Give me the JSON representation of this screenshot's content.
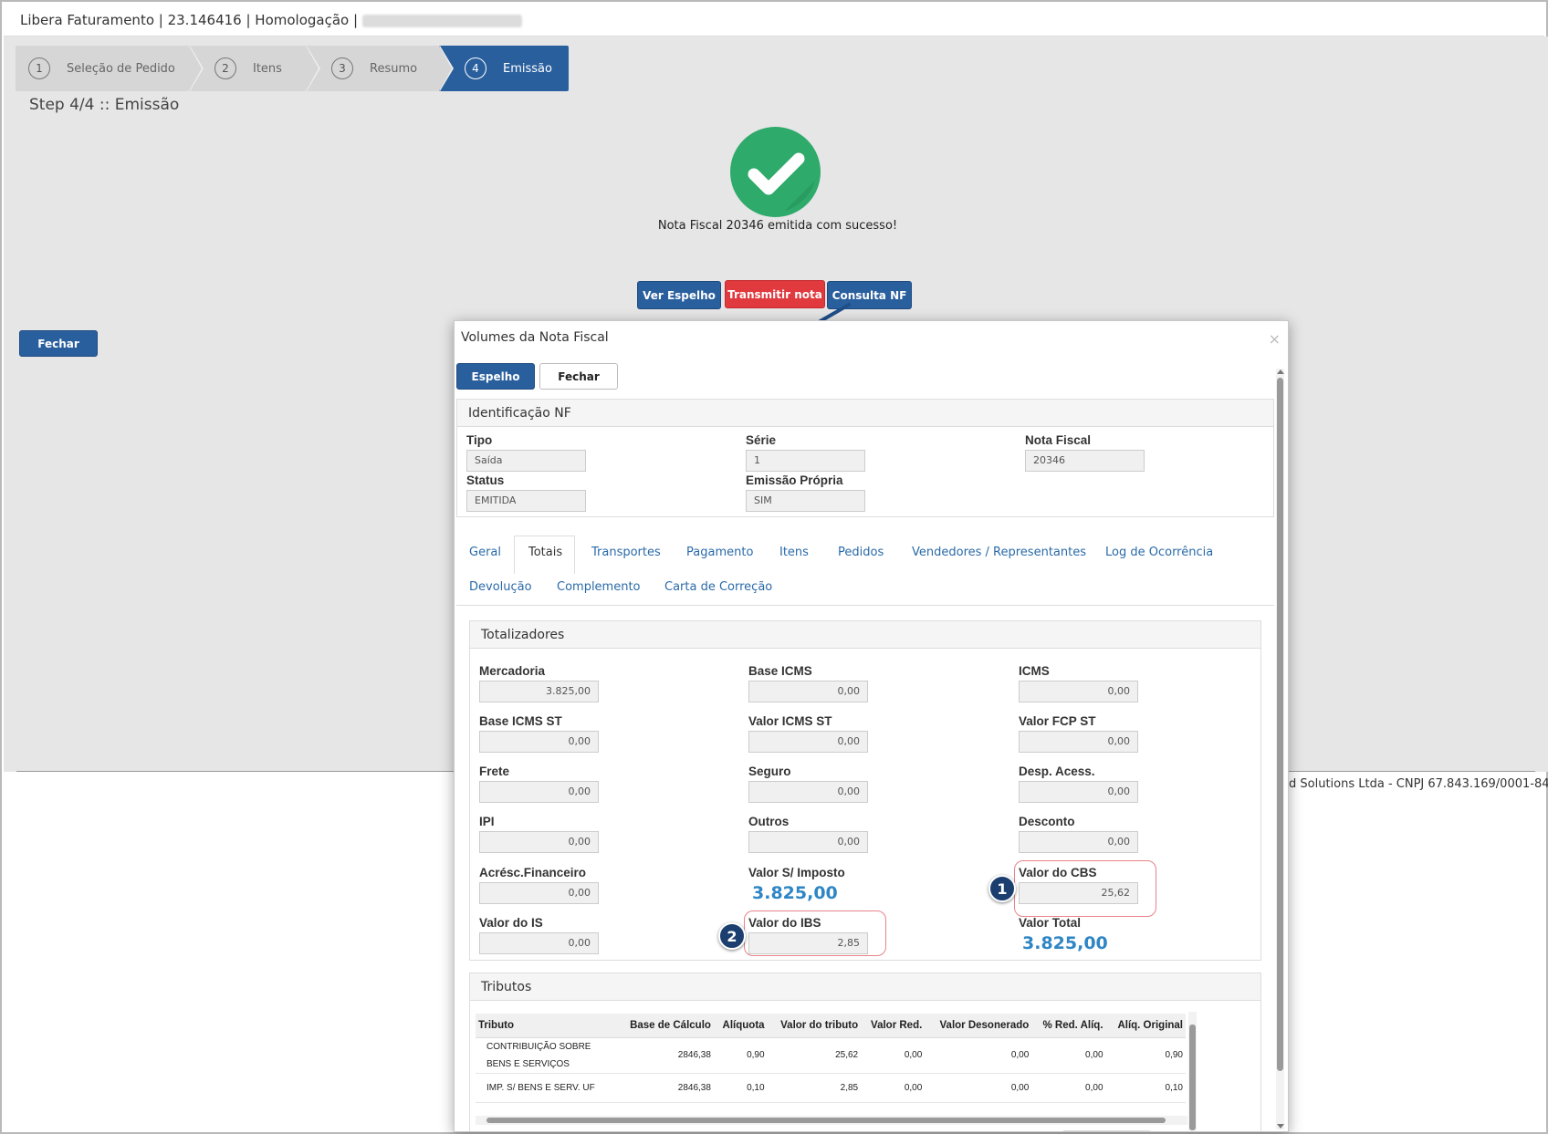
{
  "header": {
    "title": "Libera Faturamento | 23.146416 | Homologação |"
  },
  "wizard": {
    "steps": [
      {
        "num": "1",
        "label": "Seleção de Pedido"
      },
      {
        "num": "2",
        "label": "Itens"
      },
      {
        "num": "3",
        "label": "Resumo"
      },
      {
        "num": "4",
        "label": "Emissão"
      }
    ],
    "step_title": "Step 4/4 :: Emissão"
  },
  "success": {
    "message": "Nota Fiscal 20346 emitida com sucesso!"
  },
  "actions": {
    "ver_espelho": "Ver Espelho",
    "transmitir": "Transmitir nota",
    "consulta": "Consulta NF",
    "fechar": "Fechar"
  },
  "footer": {
    "text": "d Solutions Ltda - CNPJ 67.843.169/0001-84"
  },
  "modal": {
    "title": "Volumes da Nota Fiscal",
    "close_glyph": "×",
    "espelho_btn": "Espelho",
    "fechar_btn": "Fechar",
    "identificacao": {
      "title": "Identificação NF",
      "tipo_label": "Tipo",
      "tipo": "Saída",
      "serie_label": "Série",
      "serie": "1",
      "nf_label": "Nota Fiscal",
      "nf": "20346",
      "status_label": "Status",
      "status": "EMITIDA",
      "emissao_label": "Emissão Própria",
      "emissao": "SIM"
    },
    "tabs": {
      "geral": "Geral",
      "totais": "Totais",
      "transportes": "Transportes",
      "pagamento": "Pagamento",
      "itens": "Itens",
      "pedidos": "Pedidos",
      "vendedores": "Vendedores / Representantes",
      "log": "Log de Ocorrência",
      "devolucao": "Devolução",
      "complemento": "Complemento",
      "carta": "Carta de Correção"
    },
    "totalizadores": {
      "title": "Totalizadores",
      "mercadoria_label": "Mercadoria",
      "mercadoria": "3.825,00",
      "base_icms_label": "Base ICMS",
      "base_icms": "0,00",
      "icms_label": "ICMS",
      "icms": "0,00",
      "base_icms_st_label": "Base ICMS ST",
      "base_icms_st": "0,00",
      "valor_icms_st_label": "Valor ICMS ST",
      "valor_icms_st": "0,00",
      "fcp_st_label": "Valor FCP ST",
      "fcp_st": "0,00",
      "frete_label": "Frete",
      "frete": "0,00",
      "seguro_label": "Seguro",
      "seguro": "0,00",
      "desp_label": "Desp. Acess.",
      "desp": "0,00",
      "ipi_label": "IPI",
      "ipi": "0,00",
      "outros_label": "Outros",
      "outros": "0,00",
      "desconto_label": "Desconto",
      "desconto": "0,00",
      "acresc_label": "Acrésc.Financeiro",
      "acresc": "0,00",
      "sem_imposto_label": "Valor S/ Imposto",
      "sem_imposto": "3.825,00",
      "cbs_label": "Valor do CBS",
      "cbs": "25,62",
      "is_label": "Valor do IS",
      "is": "0,00",
      "ibs_label": "Valor do IBS",
      "ibs": "2,85",
      "total_label": "Valor Total",
      "total": "3.825,00"
    },
    "badges": {
      "one": "1",
      "two": "2"
    },
    "tributos": {
      "title": "Tributos",
      "headers": [
        "Tributo",
        "Base de Cálculo",
        "Alíquota",
        "Valor do tributo",
        "Valor Red.",
        "Valor Desonerado",
        "% Red. Alíq.",
        "Alíq. Original"
      ],
      "rows": [
        [
          "CONTRIBUIÇÃO SOBRE BENS E SERVIÇOS",
          "2846,38",
          "0,90",
          "25,62",
          "0,00",
          "0,00",
          "0,00",
          "0,90"
        ],
        [
          "IMP. S/ BENS E SERV. UF",
          "2846,38",
          "0,10",
          "2,85",
          "0,00",
          "0,00",
          "0,00",
          "0,10"
        ]
      ]
    }
  }
}
